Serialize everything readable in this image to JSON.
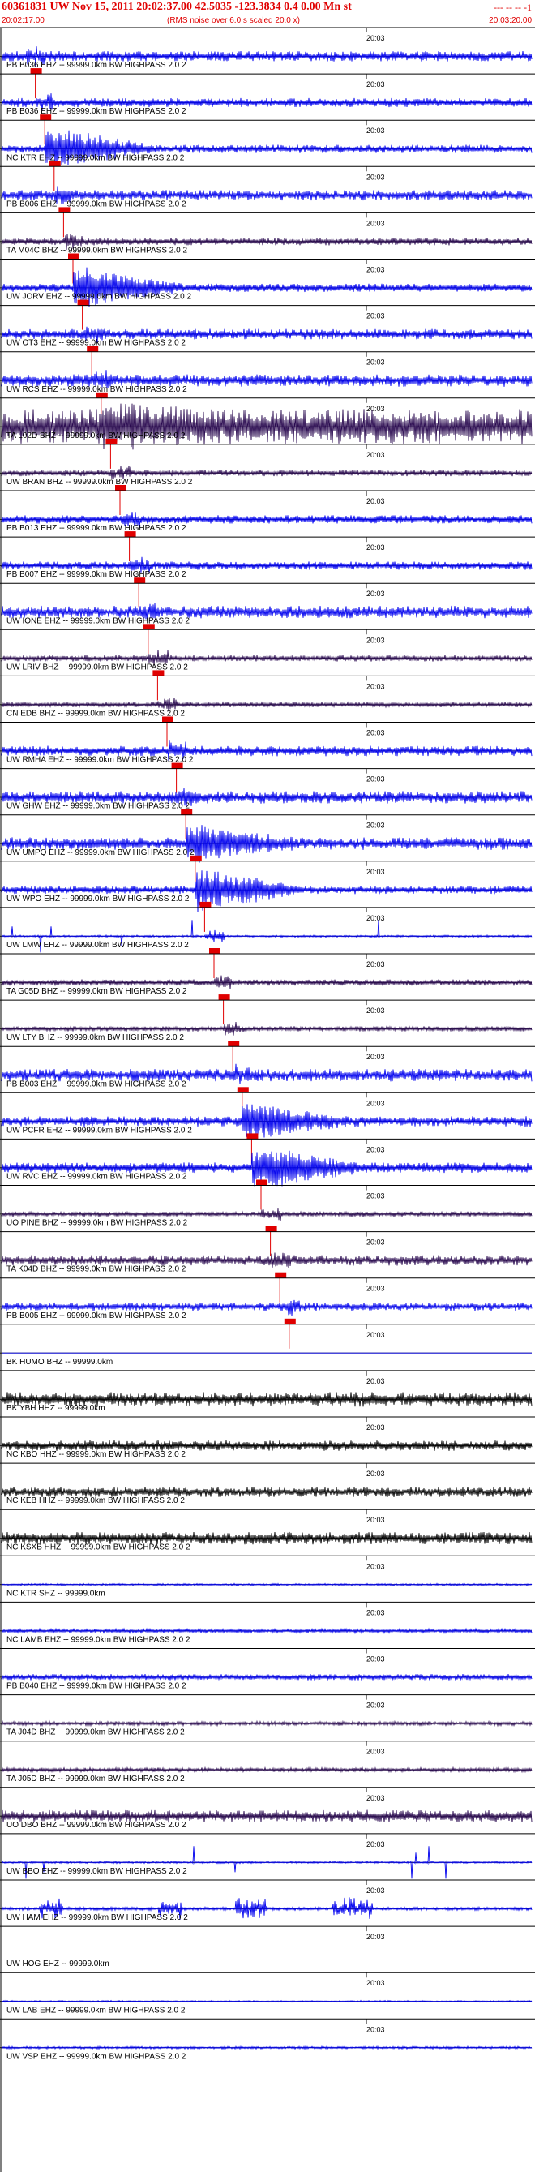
{
  "header": {
    "title": "60361831 UW Nov 15, 2011 20:02:37.00   42.5035 -123.3834  0.4 0.00 Mn st",
    "dashes": "--- -- --  -1",
    "start_time": "20:02:17.00",
    "note": "(RMS noise over 6.0 s scaled 20.0 x)",
    "end_time": "20:03:20.00",
    "minute_label": "20:03"
  },
  "chart_data": {
    "type": "line",
    "title": "60361831 UW Nov 15, 2011 20:02:37.00   42.5035 -123.3834  0.4 0.00 Mn st",
    "x_range": [
      "20:02:17.00",
      "20:03:20.00"
    ],
    "minute_tick": "20:03",
    "colors": {
      "blue": "#0000ee",
      "purple": "#2a0a50",
      "black": "#000000",
      "pick": "#e00000",
      "axis": "#000000"
    },
    "traces": [
      {
        "label": "PB B036 EHZ -- 99999.0km BW  HIGHPASS  2.0  2",
        "color": "blue",
        "amp": 0.25,
        "pick": true
      },
      {
        "label": "PB B036 EHZ -- 99999.0km BW  HIGHPASS  2.0  2",
        "color": "blue",
        "amp": 0.22,
        "pick": true
      },
      {
        "label": "NC KTR EHZ -- 99999.0km BW  HIGHPASS  2.0  2",
        "color": "blue",
        "amp": 0.2,
        "pick": true,
        "burst": 1.0
      },
      {
        "label": "PB B006 EHZ -- 99999.0km BW  HIGHPASS  2.0  2",
        "color": "blue",
        "amp": 0.25,
        "pick": true
      },
      {
        "label": "TA M04C BHZ -- 99999.0km BW  HIGHPASS  2.0  2",
        "color": "purple",
        "amp": 0.18,
        "pick": true
      },
      {
        "label": "UW JORV EHZ -- 99999.0km BW  HIGHPASS  2.0  2",
        "color": "blue",
        "amp": 0.2,
        "pick": true,
        "burst": 1.0
      },
      {
        "label": "UW OT3 EHZ -- 99999.0km BW  HIGHPASS  2.0  2",
        "color": "blue",
        "amp": 0.25,
        "pick": true
      },
      {
        "label": "UW RCS EHZ -- 99999.0km BW  HIGHPASS  2.0  2",
        "color": "blue",
        "amp": 0.3,
        "pick": true
      },
      {
        "label": "TA L02D BHZ -- 99999.0km BW  HIGHPASS  2.0  2",
        "color": "purple",
        "amp": 0.85,
        "pick": true,
        "burst": 0.6
      },
      {
        "label": "UW BRAN BHZ -- 99999.0km BW  HIGHPASS  2.0  2",
        "color": "purple",
        "amp": 0.15,
        "pick": true
      },
      {
        "label": "PB B013 EHZ -- 99999.0km BW  HIGHPASS  2.0  2",
        "color": "blue",
        "amp": 0.2,
        "pick": true
      },
      {
        "label": "PB B007 EHZ -- 99999.0km BW  HIGHPASS  2.0  2",
        "color": "blue",
        "amp": 0.2,
        "pick": true
      },
      {
        "label": "UW IONE EHZ -- 99999.0km BW  HIGHPASS  2.0  2",
        "color": "blue",
        "amp": 0.3,
        "pick": true
      },
      {
        "label": "UW LRIV BHZ -- 99999.0km BW  HIGHPASS  2.0  2",
        "color": "purple",
        "amp": 0.15,
        "pick": true
      },
      {
        "label": "CN EDB BHZ -- 99999.0km BW  HIGHPASS  2.0  2",
        "color": "purple",
        "amp": 0.12,
        "pick": true
      },
      {
        "label": "UW RMHA EHZ -- 99999.0km BW  HIGHPASS  2.0  2",
        "color": "blue",
        "amp": 0.25,
        "pick": true
      },
      {
        "label": "UW GHW EHZ -- 99999.0km BW  HIGHPASS  2.0  2",
        "color": "blue",
        "amp": 0.3,
        "pick": true
      },
      {
        "label": "UW UMPQ EHZ -- 99999.0km BW  HIGHPASS  2.0  2",
        "color": "blue",
        "amp": 0.3,
        "pick": true,
        "burst": 0.8
      },
      {
        "label": "UW WPO EHZ -- 99999.0km BW  HIGHPASS  2.0  2",
        "color": "blue",
        "amp": 0.2,
        "pick": true,
        "burst": 1.0
      },
      {
        "label": "UW LMW EHZ -- 99999.0km BW  HIGHPASS  2.0  2",
        "color": "blue",
        "amp": 0.05,
        "pick": true,
        "spikes": true
      },
      {
        "label": "TA G05D BHZ -- 99999.0km BW  HIGHPASS  2.0  2",
        "color": "purple",
        "amp": 0.15,
        "pick": true
      },
      {
        "label": "UW LTY BHZ -- 99999.0km BW  HIGHPASS  2.0  2",
        "color": "purple",
        "amp": 0.12,
        "pick": true
      },
      {
        "label": "PB B003 EHZ -- 99999.0km BW  HIGHPASS  2.0  2",
        "color": "blue",
        "amp": 0.3,
        "pick": true
      },
      {
        "label": "UW PCFR EHZ -- 99999.0km BW  HIGHPASS  2.0  2",
        "color": "blue",
        "amp": 0.25,
        "pick": true,
        "burst": 0.8
      },
      {
        "label": "UW RVC EHZ -- 99999.0km BW  HIGHPASS  2.0  2",
        "color": "blue",
        "amp": 0.25,
        "pick": true,
        "burst": 1.0
      },
      {
        "label": "UO PINE BHZ -- 99999.0km BW  HIGHPASS  2.0  2",
        "color": "purple",
        "amp": 0.12,
        "pick": true
      },
      {
        "label": "TA K04D BHZ -- 99999.0km BW  HIGHPASS  2.0  2",
        "color": "purple",
        "amp": 0.25,
        "pick": true
      },
      {
        "label": "PB B005 EHZ -- 99999.0km BW  HIGHPASS  2.0  2",
        "color": "blue",
        "amp": 0.2,
        "pick": true
      },
      {
        "label": "BK HUMO BHZ -- 99999.0km",
        "color": "blue",
        "amp": 0.0,
        "pick": false
      },
      {
        "label": "BK YBH HHZ -- 99999.0km",
        "color": "black",
        "amp": 0.35,
        "pick": false
      },
      {
        "label": "NC KBO HHZ -- 99999.0km BW  HIGHPASS  2.0  2",
        "color": "black",
        "amp": 0.25,
        "pick": false
      },
      {
        "label": "NC KEB HHZ -- 99999.0km BW  HIGHPASS  2.0  2",
        "color": "black",
        "amp": 0.25,
        "pick": false
      },
      {
        "label": "NC KSXB HHZ -- 99999.0km BW  HIGHPASS  2.0  2",
        "color": "black",
        "amp": 0.3,
        "pick": false
      },
      {
        "label": "NC KTR SHZ -- 99999.0km",
        "color": "blue",
        "amp": 0.05,
        "pick": false
      },
      {
        "label": "NC LAMB EHZ -- 99999.0km BW  HIGHPASS  2.0  2",
        "color": "blue",
        "amp": 0.1,
        "pick": false
      },
      {
        "label": "PB B040 EHZ -- 99999.0km BW  HIGHPASS  2.0  2",
        "color": "blue",
        "amp": 0.15,
        "pick": false
      },
      {
        "label": "TA J04D BHZ -- 99999.0km BW  HIGHPASS  2.0  2",
        "color": "purple",
        "amp": 0.1,
        "pick": false
      },
      {
        "label": "TA J05D BHZ -- 99999.0km BW  HIGHPASS  2.0  2",
        "color": "purple",
        "amp": 0.1,
        "pick": false
      },
      {
        "label": "UO DBO BHZ -- 99999.0km BW  HIGHPASS  2.0  2",
        "color": "purple",
        "amp": 0.3,
        "pick": false
      },
      {
        "label": "UW BBO EHZ -- 99999.0km BW  HIGHPASS  2.0  2",
        "color": "blue",
        "amp": 0.05,
        "pick": false,
        "spikes": true
      },
      {
        "label": "UW HAM EHZ -- 99999.0km BW  HIGHPASS  2.0  2",
        "color": "blue",
        "amp": 0.08,
        "pick": false,
        "bursts": true
      },
      {
        "label": "UW HOG EHZ -- 99999.0km",
        "color": "blue",
        "amp": 0.0,
        "pick": false
      },
      {
        "label": "UW LAB EHZ -- 99999.0km BW  HIGHPASS  2.0  2",
        "color": "blue",
        "amp": 0.04,
        "pick": false
      },
      {
        "label": "UW VSP EHZ -- 99999.0km BW  HIGHPASS  2.0  2",
        "color": "blue",
        "amp": 0.06,
        "pick": false
      }
    ]
  }
}
